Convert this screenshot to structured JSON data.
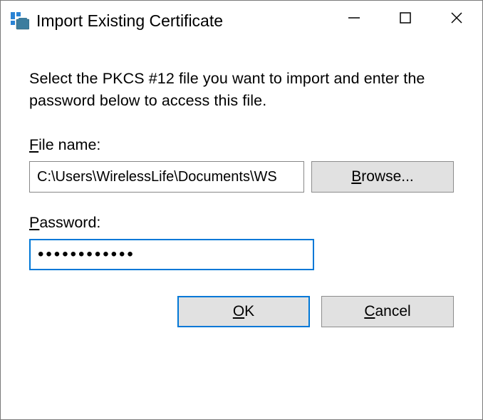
{
  "window": {
    "title": "Import Existing Certificate"
  },
  "content": {
    "instruction": "Select the PKCS #12 file you want to import and enter the password below to access this file.",
    "file_label_pre": "F",
    "file_label_post": "ile name:",
    "file_value": "C:\\Users\\WirelessLife\\Documents\\WS",
    "browse_pre": "B",
    "browse_post": "rowse...",
    "password_label_pre": "P",
    "password_label_post": "assword:",
    "password_value": "••••••••••••",
    "ok_pre": "O",
    "ok_post": "K",
    "cancel_pre": "C",
    "cancel_post": "ancel"
  }
}
